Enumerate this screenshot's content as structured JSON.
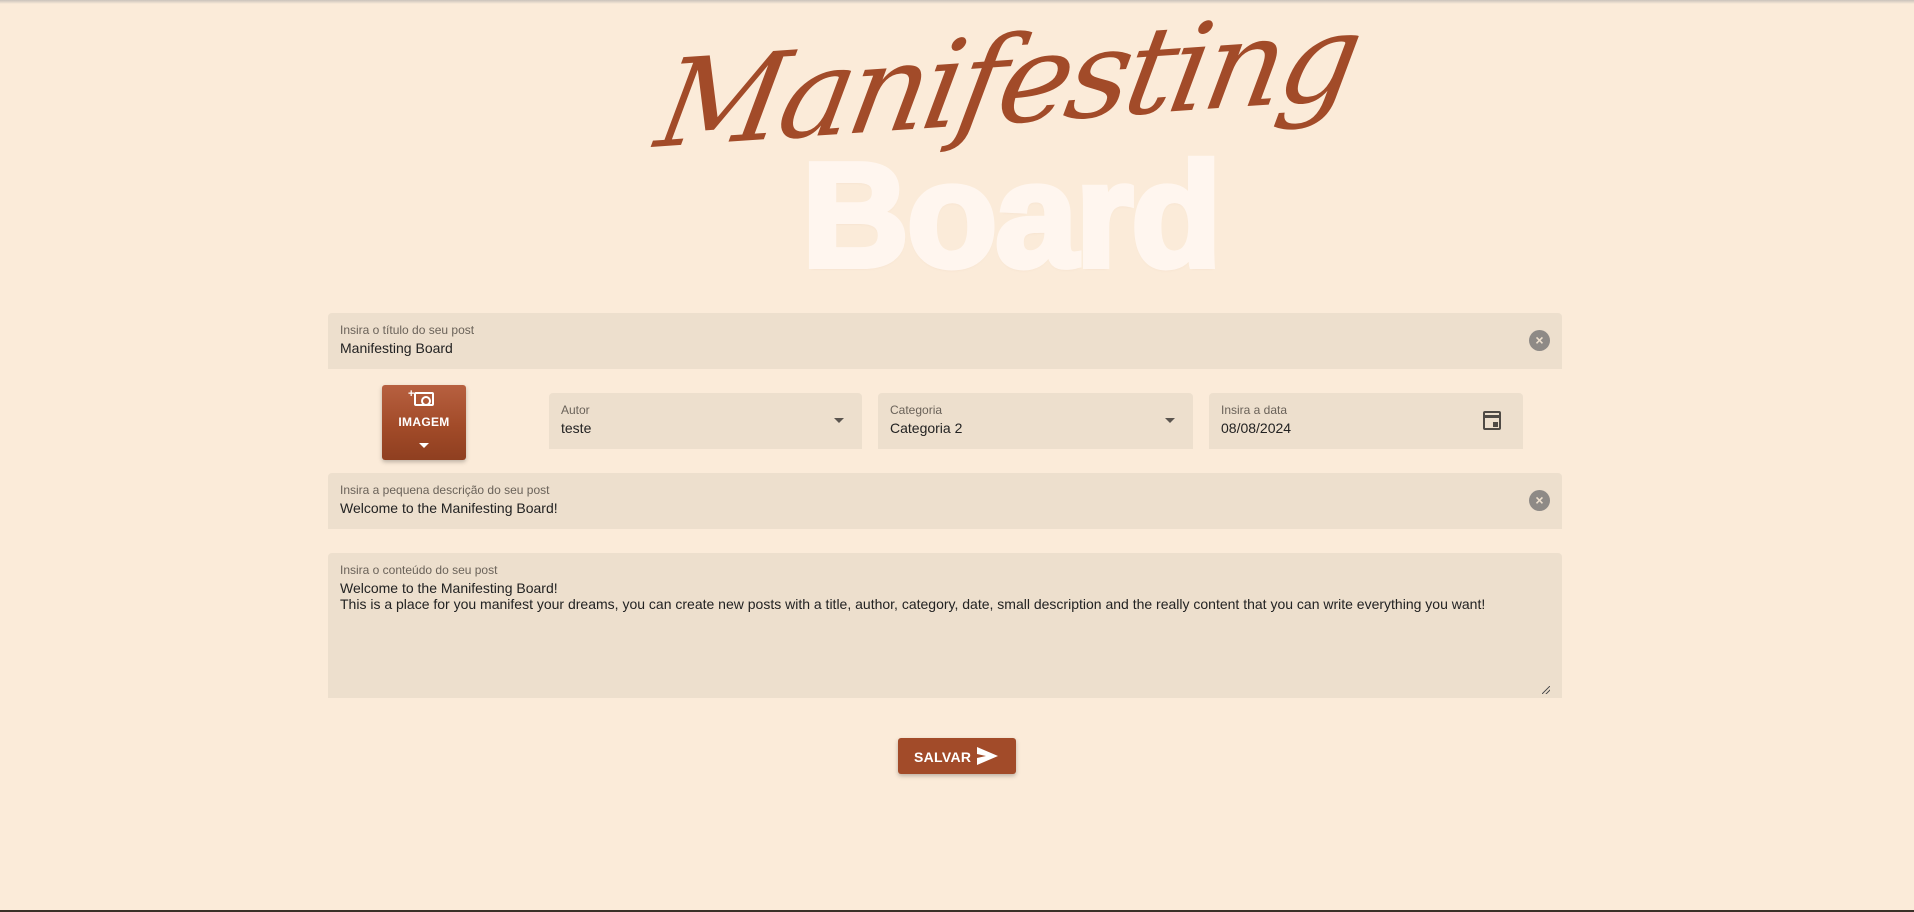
{
  "logo": {
    "script_text": "Manifesting",
    "block_text": "Board"
  },
  "form": {
    "title": {
      "label": "Insira o título do seu post",
      "value": "Manifesting Board",
      "clear_icon": "close-circle-icon"
    },
    "image_button": {
      "label": "IMAGEM",
      "icon": "add-photo-icon"
    },
    "author": {
      "label": "Autor",
      "value": "teste"
    },
    "category": {
      "label": "Categoria",
      "value": "Categoria 2"
    },
    "date": {
      "label": "Insira a data",
      "value": "08/08/2024",
      "icon": "calendar-icon"
    },
    "short_description": {
      "label": "Insira a pequena descrição do seu post",
      "value": "Welcome to the Manifesting Board!",
      "clear_icon": "close-circle-icon"
    },
    "content": {
      "label": "Insira o conteúdo do seu post",
      "value": "Welcome to the Manifesting Board!\nThis is a place for you manifest your dreams, you can create new posts with a title, author, category, date, small description and the really content that you can write everything you want!"
    },
    "save_button": {
      "label": "SALVAR",
      "icon": "send-icon"
    }
  },
  "colors": {
    "background": "#fbebd9",
    "field_background": "#eddfcd",
    "accent": "#a24b29",
    "logo_block": "#fff6ef"
  }
}
